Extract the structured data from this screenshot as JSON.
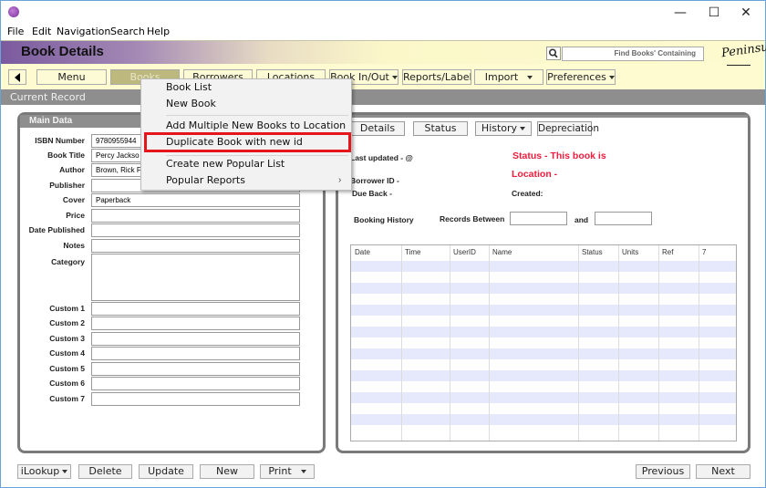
{
  "window": {
    "icon": "app-icon",
    "controls": {
      "minimize": "—",
      "maximize": "☐",
      "close": "✕"
    }
  },
  "menubar": [
    "File",
    "Edit",
    "Navigation",
    "Search",
    "Help"
  ],
  "header": {
    "title": "Book Details",
    "search_placeholder": "Find Books' Containing",
    "logo_text": "Peninsula"
  },
  "toolbar": {
    "back_icon": "triangle-left-icon",
    "buttons": [
      {
        "label": "Menu",
        "dropdown": false,
        "active": false
      },
      {
        "label": "Books",
        "dropdown": false,
        "active": true
      },
      {
        "label": "Borrowers",
        "dropdown": false,
        "active": false
      },
      {
        "label": "Locations",
        "dropdown": false,
        "active": false
      },
      {
        "label": "Book In/Out",
        "dropdown": true,
        "active": false
      },
      {
        "label": "Reports/Labels",
        "dropdown": true,
        "active": false
      },
      {
        "label": "Import",
        "dropdown": true,
        "active": false
      },
      {
        "label": "Preferences",
        "dropdown": true,
        "active": false
      }
    ]
  },
  "record_bar": {
    "label": "Current Record"
  },
  "main_data": {
    "title": "Main Data",
    "fields": [
      {
        "label": "ISBN Number",
        "value": "9780955944"
      },
      {
        "label": "Book Title",
        "value": "Percy Jackso"
      },
      {
        "label": "Author",
        "value": "Brown, Rick F"
      },
      {
        "label": "Publisher",
        "value": ""
      },
      {
        "label": "Cover",
        "value": "Paperback"
      },
      {
        "label": "Price",
        "value": ""
      },
      {
        "label": "Date Published",
        "value": ""
      },
      {
        "label": "Notes",
        "value": ""
      },
      {
        "label": "Category",
        "value": ""
      },
      {
        "label": "Custom 1",
        "value": ""
      },
      {
        "label": "Custom 2",
        "value": ""
      },
      {
        "label": "Custom 3",
        "value": ""
      },
      {
        "label": "Custom 4",
        "value": ""
      },
      {
        "label": "Custom 5",
        "value": ""
      },
      {
        "label": "Custom 6",
        "value": ""
      },
      {
        "label": "Custom 7",
        "value": ""
      }
    ]
  },
  "details": {
    "tabs": [
      {
        "label": "Details",
        "dropdown": false
      },
      {
        "label": "Status",
        "dropdown": false
      },
      {
        "label": "History",
        "dropdown": true
      },
      {
        "label": "Depreciation",
        "dropdown": false
      }
    ],
    "last_updated": "Last updated -  @",
    "borrower_id": "Borrower ID -",
    "due_back": "Due Back -",
    "status_text": "Status - This book is",
    "location_text": "Location -",
    "created": "Created:",
    "booking_history_label": "Booking History",
    "records_between_label": "Records Between",
    "and_label": "and",
    "date_from": "",
    "date_to": "",
    "table": {
      "columns": [
        "Date",
        "Time",
        "UserID",
        "Name",
        "Status",
        "Units",
        "Ref",
        "7"
      ],
      "rows": []
    }
  },
  "bottom_buttons": {
    "left": [
      {
        "label": "iLookup",
        "dropdown": true
      },
      {
        "label": "Delete",
        "dropdown": false
      },
      {
        "label": "Update",
        "dropdown": false
      },
      {
        "label": "New",
        "dropdown": false
      },
      {
        "label": "Print",
        "dropdown": true
      }
    ],
    "right": [
      {
        "label": "Previous"
      },
      {
        "label": "Next"
      }
    ]
  },
  "books_menu": {
    "items": [
      {
        "label": "Book List"
      },
      {
        "label": "New Book"
      },
      {
        "label": "Add Multiple New Books to Location"
      },
      {
        "label": "Duplicate Book with new id",
        "highlighted": true
      },
      {
        "label": "Create new Popular List"
      },
      {
        "label": "Popular Reports",
        "submenu": true
      }
    ],
    "highlight_color": "#e4161c"
  },
  "colors": {
    "header_purple": "#7a5a9e",
    "header_cream": "#fdfbcf",
    "active_tab": "#bdb97e",
    "record_bar": "#8e8e8e",
    "status_red": "#ee1c3c",
    "table_alt_row": "#e6e8fc"
  }
}
